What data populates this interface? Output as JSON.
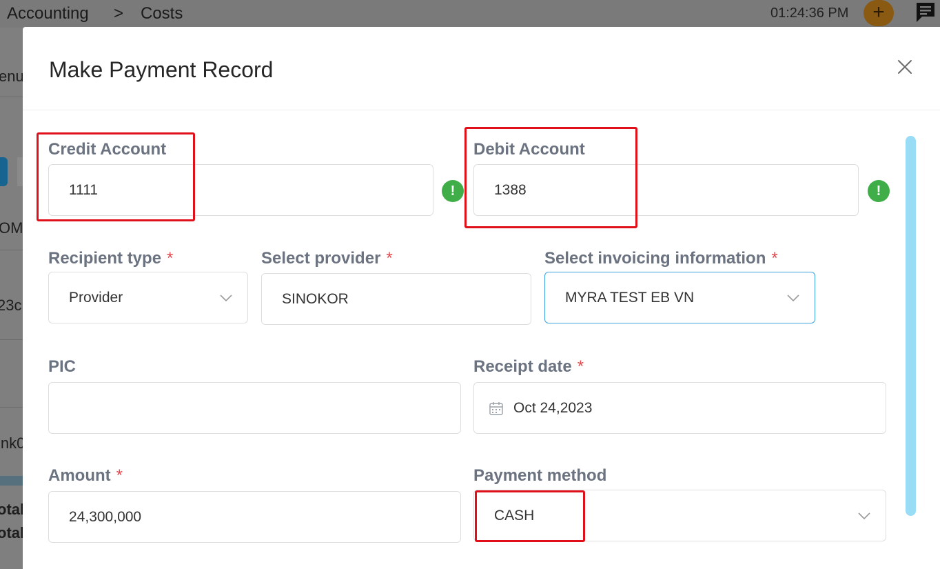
{
  "background": {
    "breadcrumb": {
      "root": "Accounting",
      "separator": ">",
      "current": "Costs"
    },
    "clock": "01:24:36 PM",
    "add_label": "+",
    "fragments": [
      "enu",
      "OM",
      "23c",
      "ink0",
      "otal",
      "otal"
    ]
  },
  "modal": {
    "title": "Make Payment Record",
    "credit_account": {
      "label": "Credit Account",
      "value": "1111"
    },
    "debit_account": {
      "label": "Debit Account",
      "value": "1388"
    },
    "recipient_type": {
      "label": "Recipient type",
      "required_mark": "*",
      "value": "Provider"
    },
    "provider": {
      "label": "Select provider",
      "required_mark": "*",
      "value": "SINOKOR"
    },
    "invoicing": {
      "label": "Select invoicing information",
      "required_mark": "*",
      "value": "MYRA TEST EB VN"
    },
    "pic": {
      "label": "PIC",
      "value": ""
    },
    "receipt_date": {
      "label": "Receipt date",
      "required_mark": "*",
      "value": "Oct 24,2023"
    },
    "amount": {
      "label": "Amount",
      "required_mark": "*",
      "value": "24,300,000"
    },
    "payment_method": {
      "label": "Payment method",
      "value": "CASH"
    },
    "warning_glyph": "!"
  },
  "colors": {
    "accent": "#3ba3e0",
    "warning_badge": "#3fae49",
    "required": "#e5484d",
    "highlight_box": "#e0101a",
    "scrollbar": "#99dcf6"
  }
}
